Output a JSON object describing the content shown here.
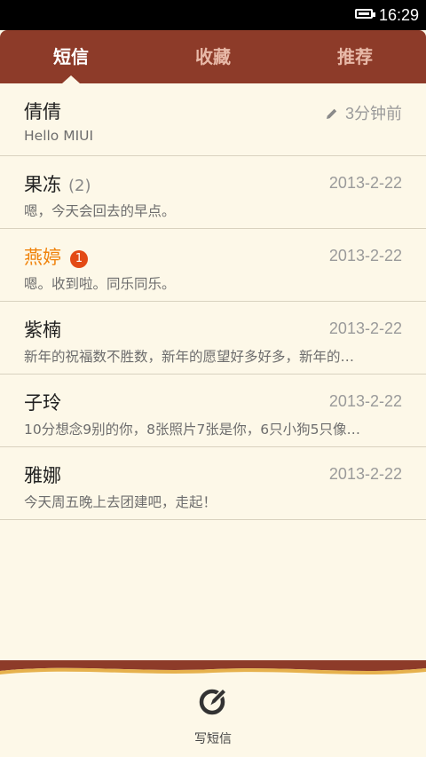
{
  "status_bar": {
    "time": "16:29"
  },
  "tabs": [
    {
      "label": "短信",
      "active": true
    },
    {
      "label": "收藏",
      "active": false
    },
    {
      "label": "推荐",
      "active": false
    }
  ],
  "conversations": [
    {
      "name": "倩倩",
      "count": "",
      "unread_badge": "",
      "date": "3分钟前",
      "draft": true,
      "preview": "Hello MIUI"
    },
    {
      "name": "果冻",
      "count": "(2)",
      "unread_badge": "",
      "date": "2013-2-22",
      "draft": false,
      "preview": "嗯，今天会回去的早点。"
    },
    {
      "name": "燕婷",
      "count": "",
      "unread_badge": "1",
      "date": "2013-2-22",
      "draft": false,
      "preview": "嗯。收到啦。同乐同乐。"
    },
    {
      "name": "紫楠",
      "count": "",
      "unread_badge": "",
      "date": "2013-2-22",
      "draft": false,
      "preview": "新年的祝福数不胜数，新年的愿望好多好多，新年的…"
    },
    {
      "name": "子玲",
      "count": "",
      "unread_badge": "",
      "date": "2013-2-22",
      "draft": false,
      "preview": "10分想念9别的你，8张照片7张是你，6只小狗5只像…"
    },
    {
      "name": "雅娜",
      "count": "",
      "unread_badge": "",
      "date": "2013-2-22",
      "draft": false,
      "preview": "今天周五晚上去团建吧，走起！"
    }
  ],
  "compose": {
    "label": "写短信",
    "icon": "compose-icon"
  },
  "colors": {
    "tab_bar": "#8d3b29",
    "background": "#fdf8e8",
    "unread_name": "#f0830c",
    "badge": "#e34a15"
  }
}
